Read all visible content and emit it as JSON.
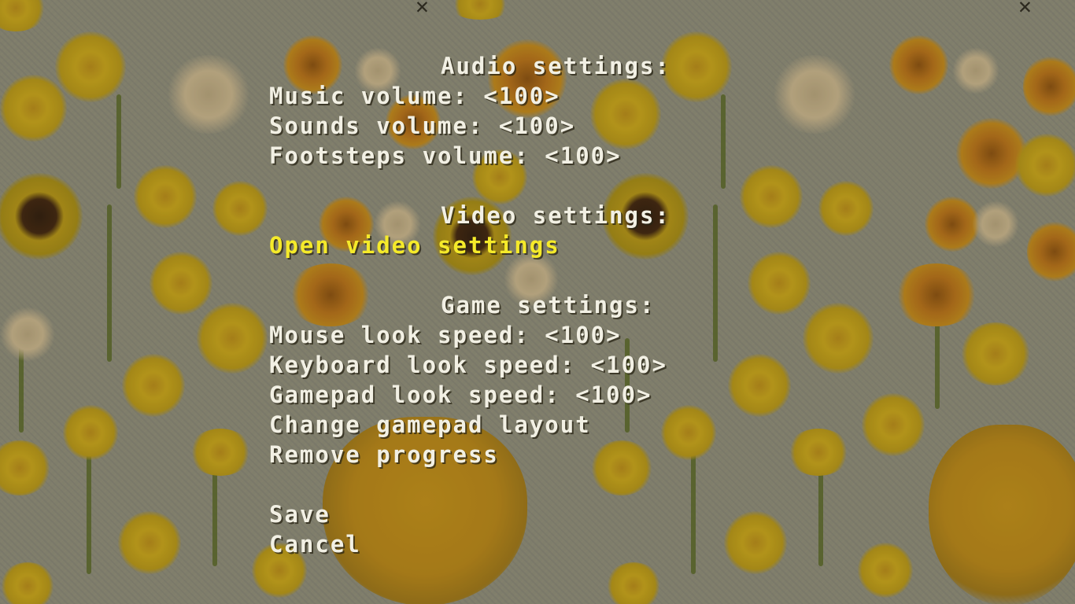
{
  "menu": {
    "audio_heading": "Audio settings:",
    "music_volume": "Music volume: <100>",
    "sounds_volume": "Sounds volume: <100>",
    "footsteps_volume": "Footsteps volume: <100>",
    "video_heading": "Video settings:",
    "open_video_settings": "Open video settings",
    "game_heading": "Game settings:",
    "mouse_look_speed": "Mouse look speed: <100>",
    "keyboard_look_speed": "Keyboard look speed: <100>",
    "gamepad_look_speed": "Gamepad look speed: <100>",
    "change_gamepad_layout": "Change gamepad layout",
    "remove_progress": "Remove progress",
    "save": "Save",
    "cancel": "Cancel"
  },
  "selected_item": "open_video_settings",
  "colors": {
    "text": "#f2f0e4",
    "selected_text": "#f5ea2a",
    "background_tint": "#8c8a76"
  },
  "icons": {
    "top_center": "close-icon",
    "top_right": "close-icon"
  }
}
